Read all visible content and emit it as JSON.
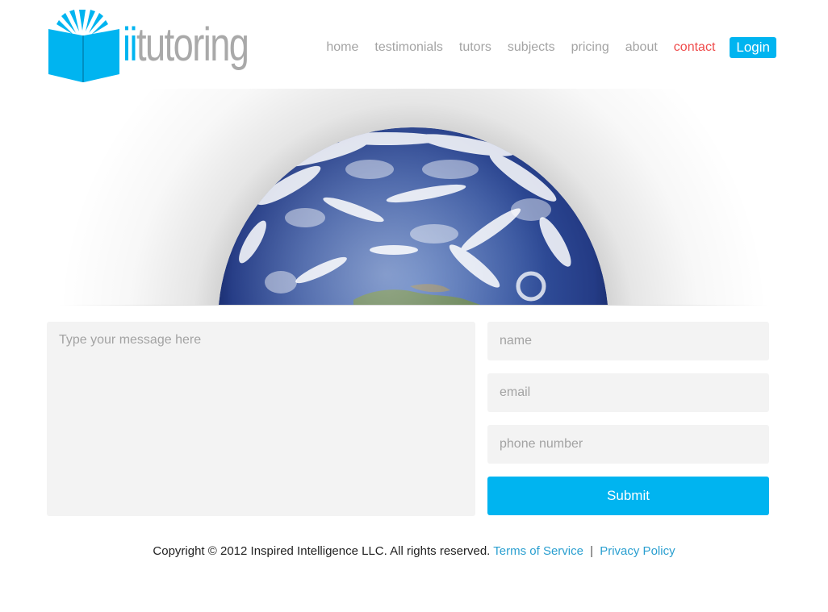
{
  "brand": {
    "logo_prefix": "ii",
    "logo_suffix": "tutoring",
    "logo_icon": "open-book-icon",
    "accent_color": "#00b4f0",
    "logo_gray": "#a9a9a9"
  },
  "nav": {
    "items": [
      {
        "label": "home"
      },
      {
        "label": "testimonials"
      },
      {
        "label": "tutors"
      },
      {
        "label": "subjects"
      },
      {
        "label": "pricing"
      },
      {
        "label": "about"
      },
      {
        "label": "contact",
        "active": true
      }
    ],
    "login_label": "Login",
    "text_color": "#a4a4a4",
    "active_color": "#ef4b4b"
  },
  "hero": {
    "image": "earth-globe-half"
  },
  "form": {
    "message_placeholder": "Type your message here",
    "name_placeholder": "name",
    "email_placeholder": "email",
    "phone_placeholder": "phone number",
    "submit_label": "Submit",
    "field_bg": "#f3f3f3"
  },
  "footer": {
    "copyright": "Copyright © 2012 Inspired Intelligence LLC. All rights reserved.",
    "terms_label": "Terms of Service",
    "separator": "|",
    "privacy_label": "Privacy Policy",
    "link_color": "#2a9fd0"
  }
}
